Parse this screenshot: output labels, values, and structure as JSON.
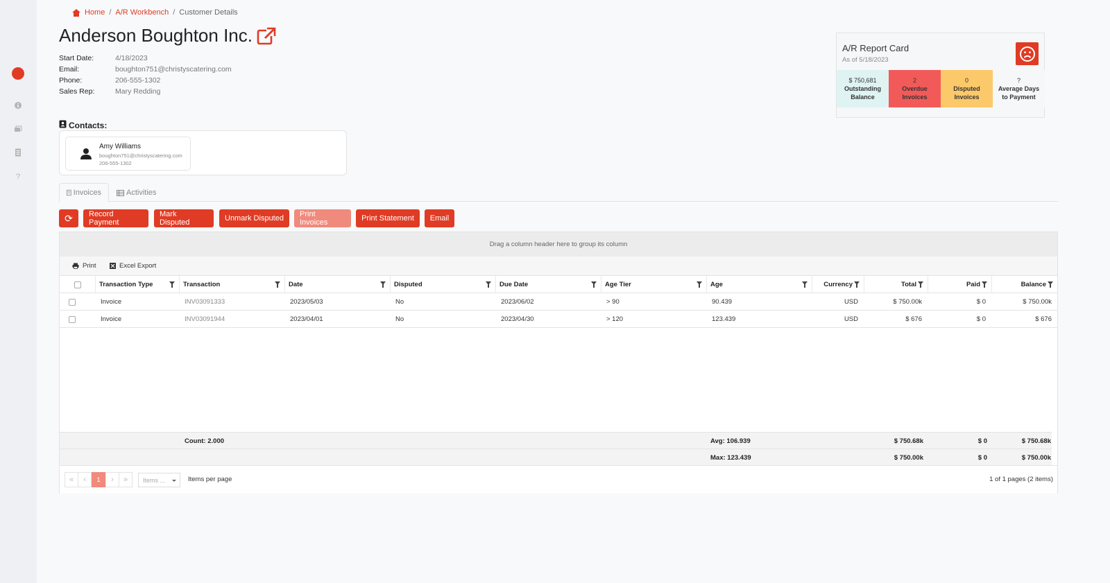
{
  "colors": {
    "accent": "#e03b24",
    "accent_light": "#f08a7c",
    "tile_balance": "#dff3f3",
    "tile_overdue": "#f25a5a",
    "tile_disputed": "#fcc96a"
  },
  "sidebar": {
    "icons": [
      "logo-icon",
      "info-icon",
      "stack-icon",
      "document-icon",
      "help-icon"
    ],
    "help_glyph": "?"
  },
  "breadcrumb": {
    "home": "Home",
    "workbench": "A/R Workbench",
    "current": "Customer Details",
    "sep": "/"
  },
  "customer": {
    "name": "Anderson Boughton Inc.",
    "fields": [
      {
        "label": "Start Date:",
        "value": "4/18/2023"
      },
      {
        "label": "Email:",
        "value": "boughton751@christyscatering.com"
      },
      {
        "label": "Phone:",
        "value": "206-555-1302"
      },
      {
        "label": "Sales Rep:",
        "value": "Mary Redding"
      }
    ]
  },
  "report_card": {
    "title": "A/R Report Card",
    "as_of": "As of 5/18/2023",
    "tiles": [
      {
        "value": "$ 750,681",
        "label1": "Outstanding",
        "label2": "Balance"
      },
      {
        "value": "2",
        "label1": "Overdue",
        "label2": "Invoices"
      },
      {
        "value": "0",
        "label1": "Disputed",
        "label2": "Invoices"
      },
      {
        "value": "?",
        "label1": "Average Days",
        "label2": "to Payment"
      }
    ]
  },
  "contacts": {
    "label": "Contacts:",
    "items": [
      {
        "name": "Amy Williams",
        "email": "boughton751@christyscatering.com",
        "phone": "206-555-1302"
      }
    ]
  },
  "tabs": [
    {
      "label": "Invoices"
    },
    {
      "label": "Activities"
    }
  ],
  "toolbar": {
    "refresh_glyph": "⟳",
    "record_payment": "Record Payment",
    "mark_disputed": "Mark Disputed",
    "unmark_disputed": "Unmark Disputed",
    "print_invoices": "Print Invoices",
    "print_statement": "Print Statement",
    "email": "Email"
  },
  "grid": {
    "group_hint": "Drag a column header here to group its column",
    "print": "Print",
    "excel_export": "Excel Export",
    "columns": [
      "Transaction Type",
      "Transaction",
      "Date",
      "Disputed",
      "Due Date",
      "Age Tier",
      "Age",
      "Currency",
      "Total",
      "Paid",
      "Balance"
    ],
    "rows": [
      {
        "type": "Invoice",
        "transaction": "INV03091333",
        "date": "2023/05/03",
        "disputed": "No",
        "due_date": "2023/06/02",
        "age_tier": "> 90",
        "age": "90.439",
        "currency": "USD",
        "total": "$ 750.00k",
        "paid": "$ 0",
        "balance": "$ 750.00k"
      },
      {
        "type": "Invoice",
        "transaction": "INV03091944",
        "date": "2023/04/01",
        "disputed": "No",
        "due_date": "2023/04/30",
        "age_tier": "> 120",
        "age": "123.439",
        "currency": "USD",
        "total": "$ 676",
        "paid": "$ 0",
        "balance": "$ 676"
      }
    ],
    "footer": [
      {
        "count": "Count: 2.000",
        "age": "Avg: 106.939",
        "total": "$ 750.68k",
        "paid": "$ 0",
        "balance": "$ 750.68k"
      },
      {
        "count": "",
        "age": "Max: 123.439",
        "total": "$ 750.00k",
        "paid": "$ 0",
        "balance": "$ 750.00k"
      }
    ],
    "pager": {
      "first": "«",
      "prev": "‹",
      "page": "1",
      "next": "›",
      "last": "»",
      "items_select": "Items ...",
      "items_per_page": "Items per page",
      "info": "1 of 1 pages (2 items)"
    }
  }
}
